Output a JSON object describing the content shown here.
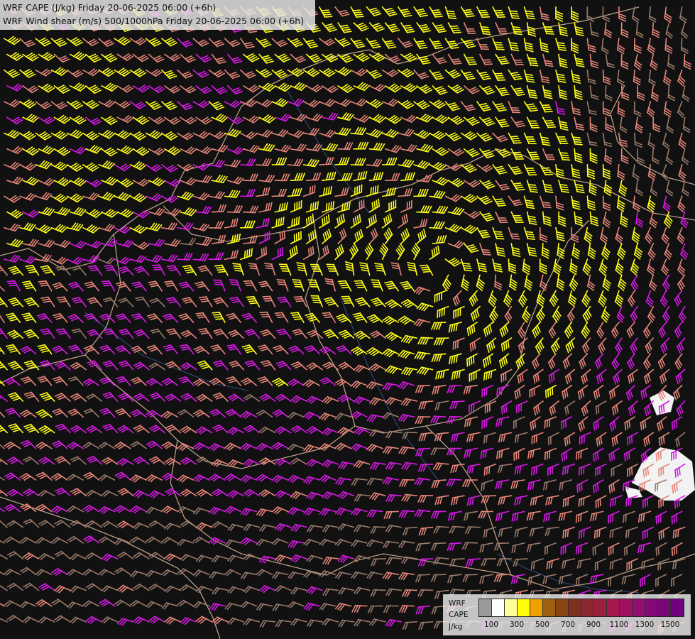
{
  "header": {
    "line1": "WRF CAPE (J/kg) Friday 20-06-2025 06:00 (+6h)",
    "line2": "WRF Wind shear (m/s) 500/1000hPa Friday 20-06-2025 06:00 (+6h)"
  },
  "legend": {
    "label_line1": "WRF",
    "label_line2": "CAPE",
    "label_unit": "J/kg",
    "swatch_colors": [
      "#9a9a9a",
      "#ffffff",
      "#ffff99",
      "#ffff00",
      "#f0a000",
      "#a06010",
      "#8b4513",
      "#7b3020",
      "#8a2a30",
      "#9a2040",
      "#a81850",
      "#a01060",
      "#900f70",
      "#800a78",
      "#78087a",
      "#700080"
    ],
    "tick_labels": [
      "100",
      "300",
      "500",
      "700",
      "900",
      "1100",
      "1300",
      "1500"
    ]
  },
  "map": {
    "background_color": "#111111",
    "shear_colors": {
      "weak": "#9a7a6a",
      "moderate": "#e7867a",
      "strong": "#d91ae6",
      "very_strong": "#ffff1a"
    },
    "border_color": "#d9b79a",
    "river_color": "#3a5a90",
    "cape_patch_color": "#ffffff"
  }
}
